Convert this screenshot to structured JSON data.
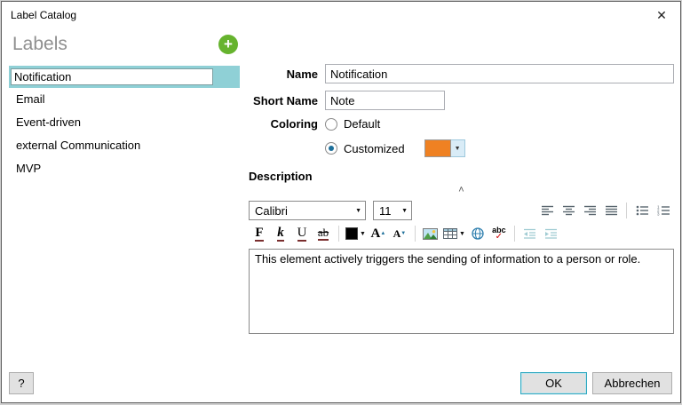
{
  "window": {
    "title": "Label Catalog"
  },
  "icons": {
    "close": "✕",
    "add": "+",
    "collapse": "˄",
    "dropdown": "▼",
    "triangle_up": "▲",
    "triangle_down": "▼",
    "help": "?",
    "check": "✓"
  },
  "sidebar": {
    "heading": "Labels",
    "items": [
      {
        "label": "Notification",
        "selected": true
      },
      {
        "label": "Email",
        "selected": false
      },
      {
        "label": "Event-driven",
        "selected": false
      },
      {
        "label": "external Communication",
        "selected": false
      },
      {
        "label": "MVP",
        "selected": false
      }
    ]
  },
  "form": {
    "name_label": "Name",
    "name_value": "Notification",
    "short_name_label": "Short Name",
    "short_name_value": "Note",
    "coloring_label": "Coloring",
    "default_option": "Default",
    "customized_option": "Customized",
    "custom_color": "#EF8122",
    "description_label": "Description"
  },
  "editor": {
    "font_family": "Calibri",
    "font_size": "11",
    "toolbar": {
      "bold": "F",
      "italic": "k",
      "underline": "U",
      "strikethrough": "ab",
      "grow": "A",
      "shrink": "A",
      "spell": "abc"
    },
    "text": "This element actively triggers the sending of information to a person or role."
  },
  "footer": {
    "ok": "OK",
    "cancel": "Abbrechen"
  }
}
